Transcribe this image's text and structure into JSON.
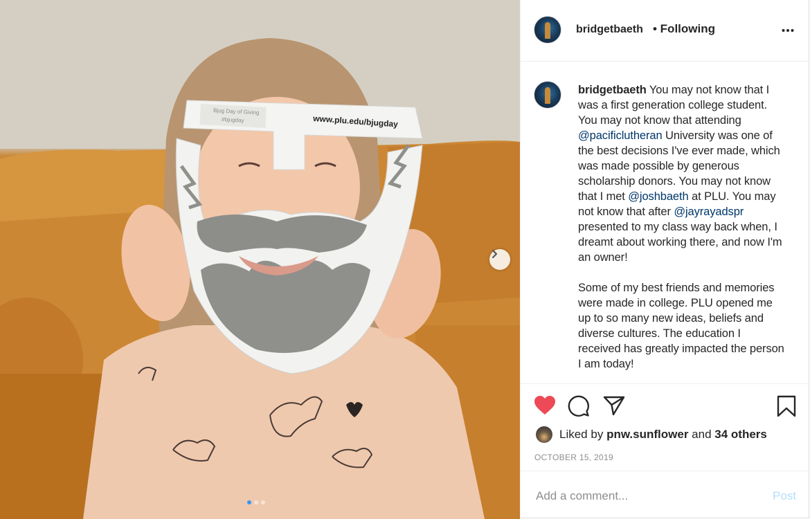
{
  "post": {
    "username": "bridgetbaeth",
    "follow_status": "• Following",
    "more_icon": "ellipsis-icon"
  },
  "caption": {
    "username": "bridgetbaeth",
    "part1": " You may not know that I was a first generation college student. You may not know that attending ",
    "mention1": "@pacificlutheran",
    "part2": " University was one of the best decisions I've ever made, which was made possible by generous scholarship donors. You may not know that I met ",
    "mention2": "@joshbaeth",
    "part3": " at PLU. You may not know that after ",
    "mention3": "@jayrayadspr",
    "part4": " presented to my class way back when, I dreamt about working there, and now I'm an owner!",
    "paragraph2": "Some of my best friends and memories were made in college. PLU opened me up to so many new ideas, beliefs and diverse cultures. The education I received has greatly impacted the person I am today!"
  },
  "photo": {
    "mask_text": "www.plu.edu/bjugday",
    "sticker_line1": "Bjug Day of Giving",
    "sticker_line2": "#bjugday",
    "slide_index": 1,
    "slide_count": 3
  },
  "likes": {
    "prefix": "Liked by ",
    "user": "pnw.sunflower",
    "middle": " and ",
    "others": "34 others"
  },
  "date": "OCTOBER 15, 2019",
  "comment": {
    "placeholder": "Add a comment...",
    "post_label": "Post"
  },
  "colors": {
    "heart": "#ed4956",
    "link": "#00376b",
    "post_disabled": "#b2dffc",
    "carousel_active": "#3897f0"
  }
}
